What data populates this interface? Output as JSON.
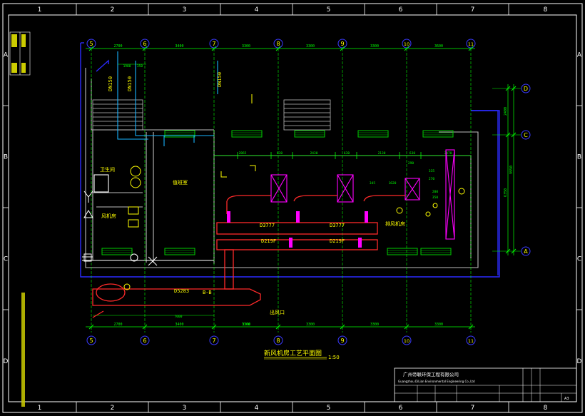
{
  "colors": {
    "background": "#000000",
    "frame": "#ffffff",
    "wall": "#bcbcbc",
    "building_outline": "#2b2bff",
    "axis_line": "#00ff00",
    "axis_bubble": "#3a3aff",
    "dimension": "#00ff00",
    "pipe_red": "#ff2a2a",
    "pipe_magenta": "#ff00ff",
    "water_pipe": "#18b4ff",
    "label_yellow": "#ffff00",
    "label_cyan": "#00ffff",
    "vent_green": "#00cc00"
  },
  "frame": {
    "col_labels": [
      "1",
      "2",
      "3",
      "4",
      "5",
      "6",
      "7",
      "8"
    ],
    "row_labels": [
      "A",
      "B",
      "C",
      "D"
    ]
  },
  "axes": {
    "horizontal": [
      "5",
      "6",
      "7",
      "8",
      "9",
      "10",
      "11"
    ],
    "vertical": [
      "D",
      "C",
      "A"
    ]
  },
  "dimensions": {
    "top_row": [
      "2700",
      "3400",
      "3300",
      "3300",
      "3300",
      "3600"
    ],
    "bottom_row": [
      "2700",
      "3400",
      "3300",
      "3300",
      "3300",
      "3300"
    ],
    "right_col": [
      "2400",
      "6350",
      "9950"
    ],
    "misc_top": [
      "1900",
      "350"
    ],
    "misc_inner": [
      "2865",
      "630",
      "2430",
      "630",
      "2130",
      "630",
      "2470",
      "345",
      "1620",
      "290",
      "335",
      "270",
      "200",
      "350",
      "3300",
      "7000"
    ]
  },
  "pipes": {
    "labels": [
      "DN150",
      "DN150",
      "DN150",
      "D3777",
      "D3777",
      "D219F",
      "D219F",
      "D5283",
      "B-B"
    ]
  },
  "rooms": {
    "labels": [
      "值班室",
      "卫生间",
      "风机房",
      "排风机房",
      "出风口"
    ]
  },
  "drawing_title": "新风机房工艺平面图",
  "drawing_scale": "1:50",
  "title_block": {
    "company_cn": "广州帝联环保工程有限公司",
    "company_en": "Guangzhou DiLian Environmental Engineering Co.,Ltd",
    "sheet_size": "A3"
  }
}
